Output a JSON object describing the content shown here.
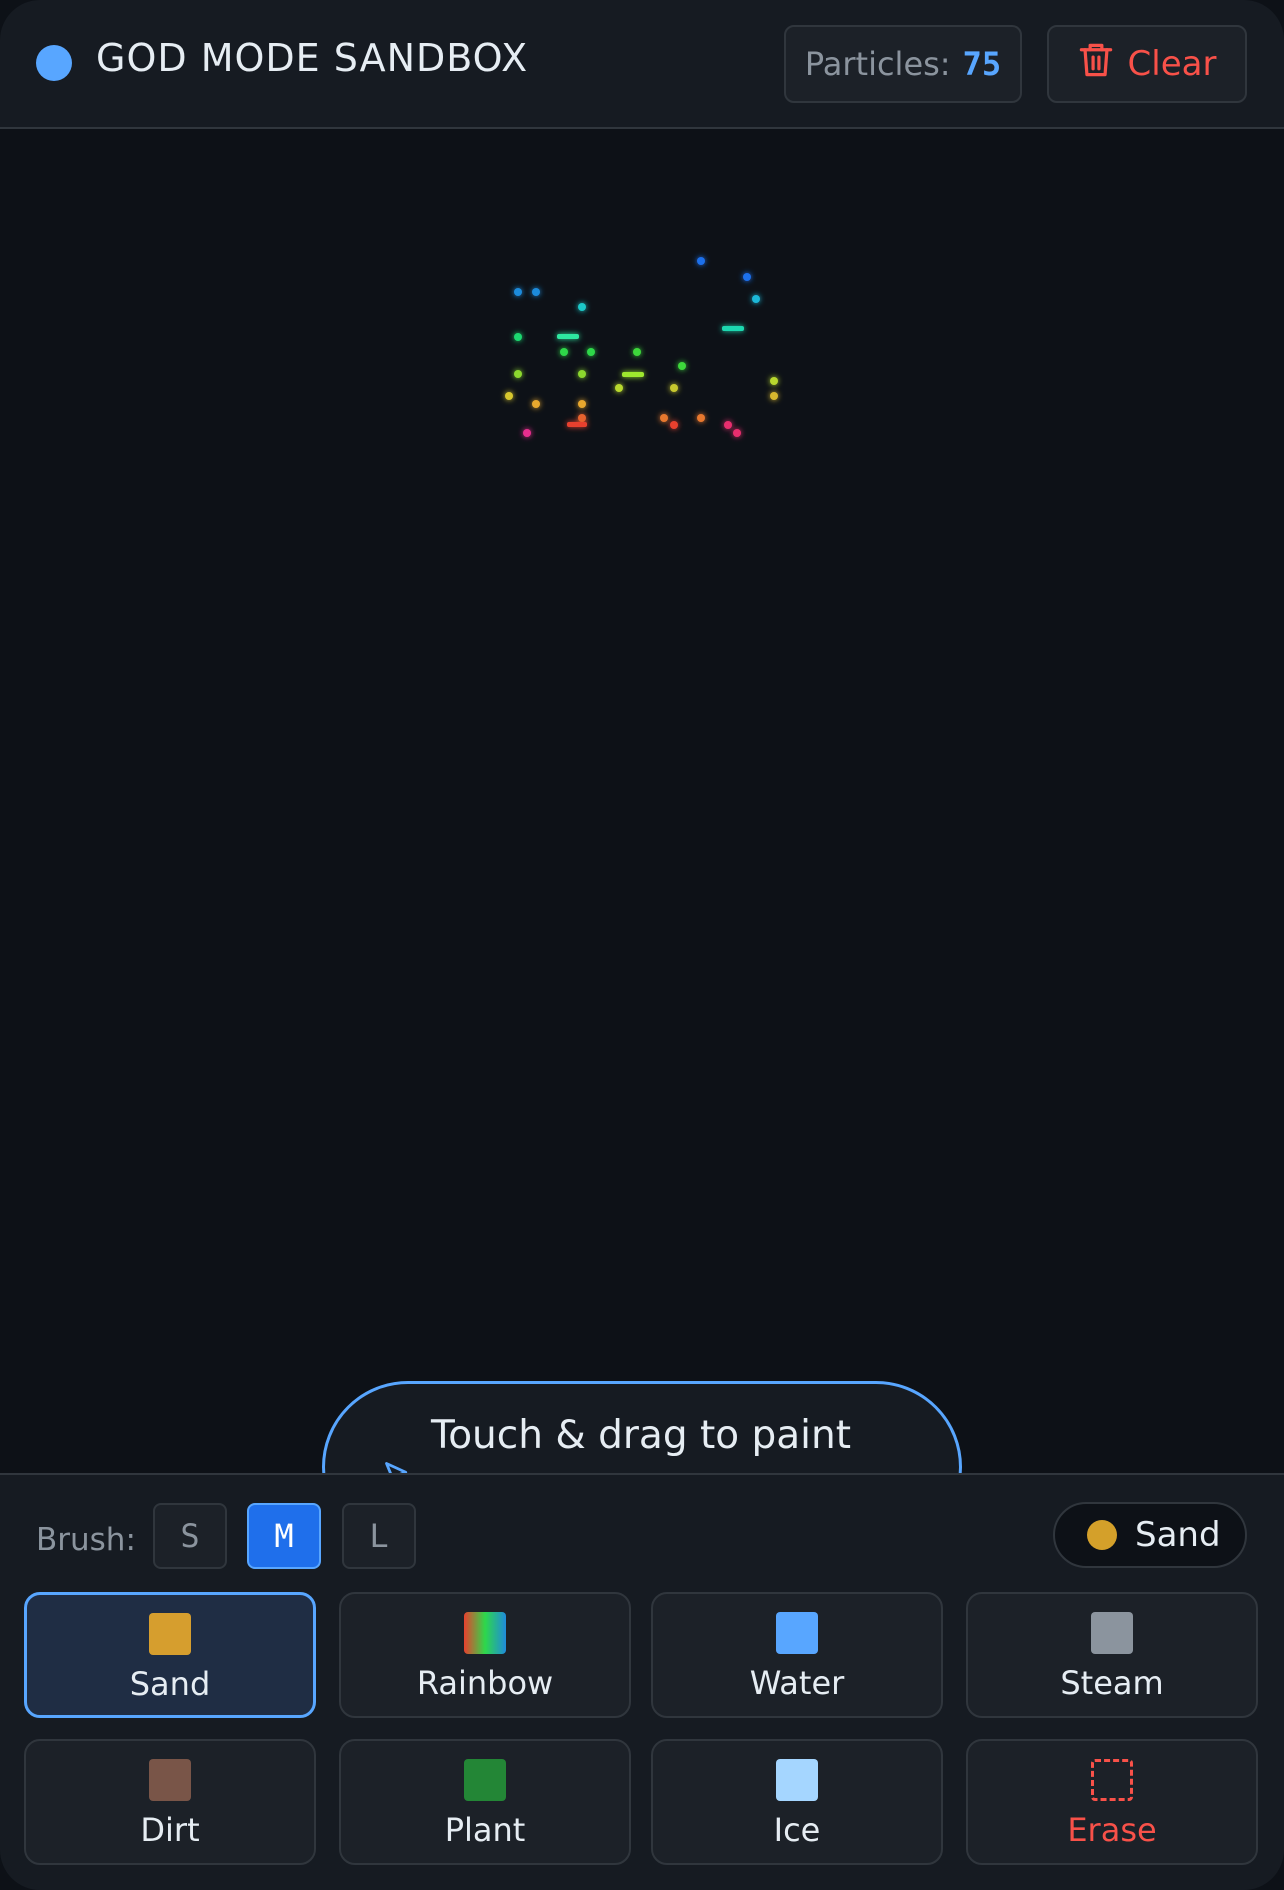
{
  "header": {
    "title": "GOD MODE SANDBOX",
    "particles_label": "Particles:",
    "particles_count": "75",
    "clear_label": "Clear"
  },
  "canvas": {
    "hint": "Touch & drag to paint elements"
  },
  "toolbar": {
    "brush_label": "Brush:",
    "brush_sizes": [
      "S",
      "M",
      "L"
    ],
    "selected_brush": "M",
    "current_element": "Sand",
    "current_color": "#d4a02a"
  },
  "elements": [
    {
      "label": "Sand",
      "color": "#d69e2e",
      "selected": true
    },
    {
      "label": "Rainbow",
      "color": "rainbow"
    },
    {
      "label": "Water",
      "color": "#58a6ff"
    },
    {
      "label": "Steam",
      "color": "#8b949e"
    },
    {
      "label": "Dirt",
      "color": "#795548"
    },
    {
      "label": "Plant",
      "color": "#238636"
    },
    {
      "label": "Ice",
      "color": "#a5d6ff"
    },
    {
      "label": "Erase",
      "color": "#f85149"
    }
  ],
  "colors": {
    "accent": "#58a6ff",
    "danger": "#f85149",
    "background": "#0d1117"
  }
}
